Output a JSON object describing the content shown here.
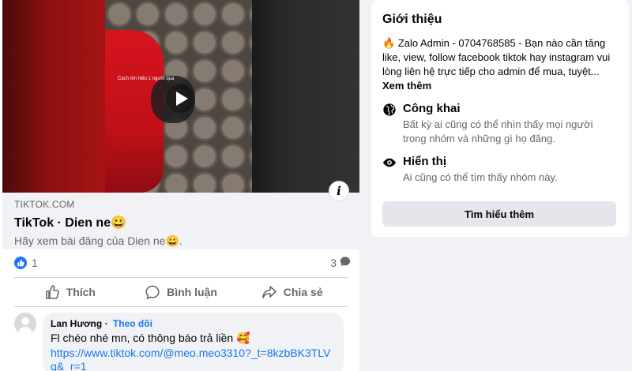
{
  "post": {
    "video_caption": "Cách tìm hiểu 1 người qua",
    "link": {
      "domain": "TIKTOK.COM",
      "title": "TikTok · Dien ne😀",
      "description": "Hãy xem bài đăng của Dien ne😀."
    },
    "stats": {
      "likes": "1",
      "comments": "3"
    },
    "actions": {
      "like": "Thích",
      "comment": "Bình luận",
      "share": "Chia sẻ"
    },
    "comment": {
      "author": "Lan Hương",
      "separator": "·",
      "follow": "Theo dõi",
      "text": "Fl chéo nhé mn, có thông báo trả liền 🥰",
      "link": "https://www.tiktok.com/@meo.meo3310?_t=8kzbBK3TLVq&_r=1"
    }
  },
  "about": {
    "title": "Giới thiệu",
    "intro_emoji": "🔥",
    "intro_text": "Zalo Admin - 0704768585 - Bạn nào cần tăng like, view, follow facebook tiktok hay instagram vui lòng liên hệ trực tiếp cho admin để mua, tuyệt...",
    "see_more": "Xem thêm",
    "public_title": "Công khai",
    "public_desc": "Bất kỳ ai cũng có thể nhìn thấy mọi người trong nhóm và những gì họ đăng.",
    "visible_title": "Hiển thị",
    "visible_desc": "Ai cũng có thể tìm thấy nhóm này.",
    "learn_more": "Tìm hiểu thêm"
  },
  "colors": {
    "accent": "#1877f2",
    "secondary_text": "#65676b",
    "background": "#f0f2f5"
  },
  "icons": [
    "play-icon",
    "info-icon",
    "like-reaction-icon",
    "comment-count-icon",
    "like-icon",
    "comment-icon",
    "share-icon",
    "globe-icon",
    "eye-icon"
  ]
}
